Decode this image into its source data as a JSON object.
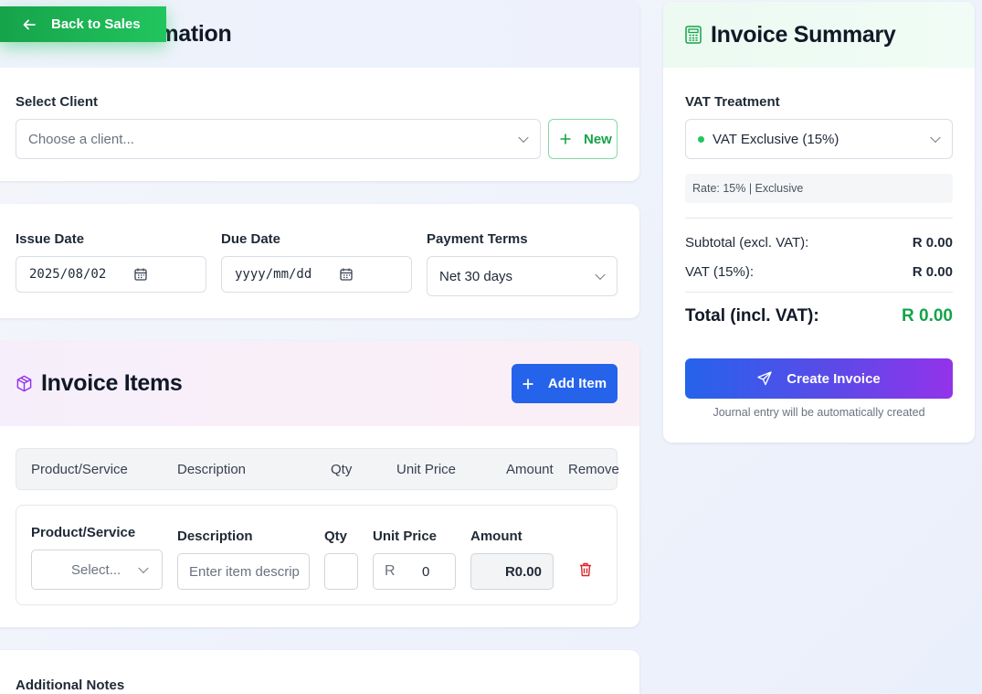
{
  "nav": {
    "back_label": "Back to Sales"
  },
  "client": {
    "title": "Client Information",
    "select_label": "Select Client",
    "select_placeholder": "Choose a client...",
    "new_label": "New"
  },
  "dates": {
    "issue_label": "Issue Date",
    "issue_value": "2025/08/02",
    "due_label": "Due Date",
    "due_value": "yyyy/mm/dd",
    "terms_label": "Payment Terms",
    "terms_value": "Net 30 days"
  },
  "items": {
    "title": "Invoice Items",
    "add_label": "Add Item",
    "headers": [
      "Product/Service",
      "Description",
      "Qty",
      "Unit Price",
      "Amount",
      "Remove"
    ],
    "row": {
      "product_label": "Product/Service",
      "product_placeholder": "Select...",
      "description_label": "Description",
      "description_placeholder": "Enter item descrip",
      "qty_label": "Qty",
      "qty_value": "",
      "unit_price_label": "Unit Price",
      "currency_prefix": "R",
      "unit_price_value": "0",
      "amount_label": "Amount",
      "amount_value": "R0.00"
    }
  },
  "notes": {
    "label": "Additional Notes"
  },
  "summary": {
    "title": "Invoice Summary",
    "vat_label": "VAT Treatment",
    "vat_value": "VAT Exclusive (15%)",
    "rate_info": "Rate: 15% | Exclusive",
    "subtotal_label": "Subtotal (excl. VAT):",
    "subtotal_value": "R 0.00",
    "vat_line_label": "VAT (15%):",
    "vat_line_value": "R 0.00",
    "total_label": "Total (incl. VAT):",
    "total_value": "R 0.00",
    "create_label": "Create Invoice",
    "footnote": "Journal entry will be automatically created"
  },
  "colors": {
    "primary": "#2563eb",
    "success": "#16a34a",
    "danger": "#dc2626",
    "accent_purple": "#9333ea"
  },
  "icons": [
    "arrow-left-icon",
    "user-icon",
    "plus-icon",
    "calendar-icon",
    "chevron-down-icon",
    "box-icon",
    "trash-icon",
    "calculator-icon",
    "send-icon",
    "status-dot-icon"
  ]
}
